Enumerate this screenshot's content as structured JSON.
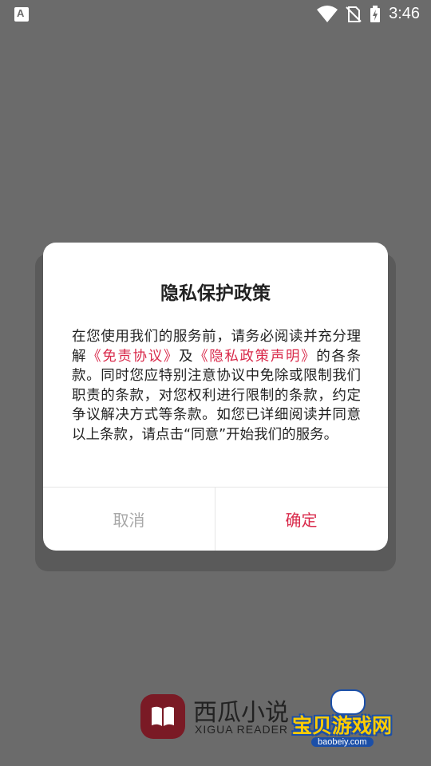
{
  "status_bar": {
    "time": "3:46"
  },
  "dialog": {
    "title": "隐私保护政策",
    "body_part1": "在您使用我们的服务前，请务必阅读并充分理解",
    "link1": "《免责协议》",
    "body_part2": "及",
    "link2": "《隐私政策声明》",
    "body_part3": "的各条款。同时您应特别注意协议中免除或限制我们职责的条款，对您权利进行限制的条款，约定争议解决方式等条款。如您已详细阅读并同意以上条款，请点击“同意”开始我们的服务。",
    "cancel_label": "取消",
    "confirm_label": "确定"
  },
  "brand": {
    "name": "西瓜小说",
    "name_en": "XIGUA READER"
  },
  "watermark": {
    "text": "宝贝游戏网",
    "url": "baobeiy.com"
  },
  "colors": {
    "accent": "#d92a4b",
    "overlay": "#6b6b6b",
    "logo": "#7a1a25"
  }
}
